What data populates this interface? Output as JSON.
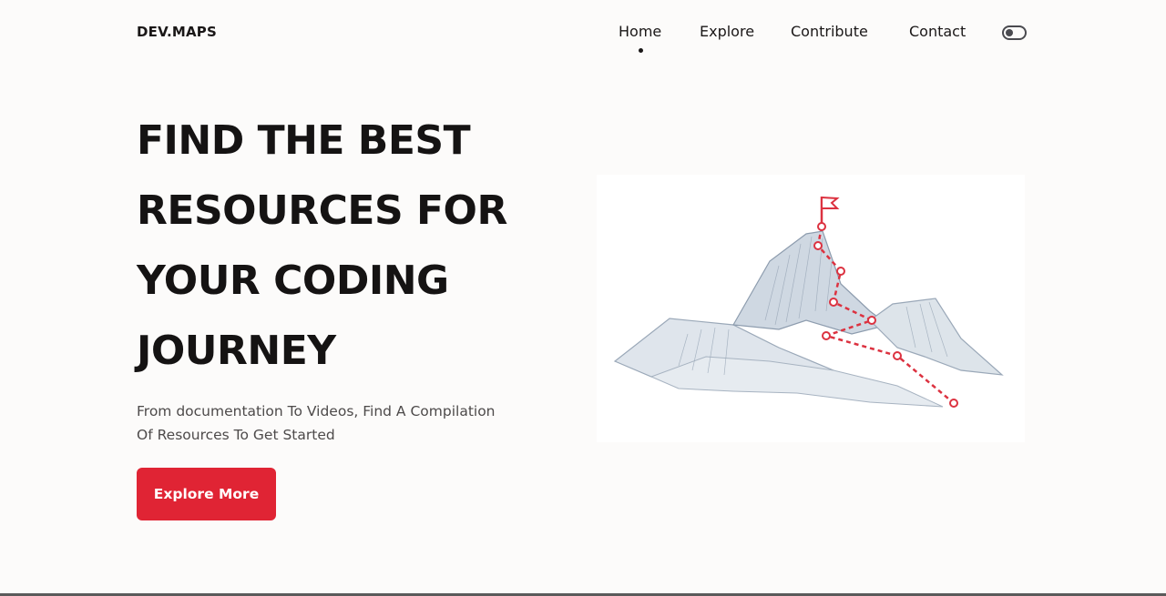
{
  "header": {
    "logo": "DEV.MAPS",
    "nav": [
      {
        "label": "Home",
        "active": true
      },
      {
        "label": "Explore",
        "active": false
      },
      {
        "label": "Contribute",
        "active": false
      },
      {
        "label": "Contact",
        "active": false
      }
    ],
    "theme_toggle_icon": "toggle-switch-icon"
  },
  "hero": {
    "title_lines": [
      "FIND THE BEST",
      "RESOURCES FOR",
      "YOUR CODING",
      "JOURNEY"
    ],
    "subtitle_lines": [
      "From documentation To Videos, Find A Compilation",
      "Of Resources To Get Started"
    ],
    "cta_label": "Explore More",
    "illustration_icon": "mountain-path-flag-icon"
  },
  "colors": {
    "accent": "#e02434",
    "text": "#151313",
    "background": "#fcfbfa"
  }
}
